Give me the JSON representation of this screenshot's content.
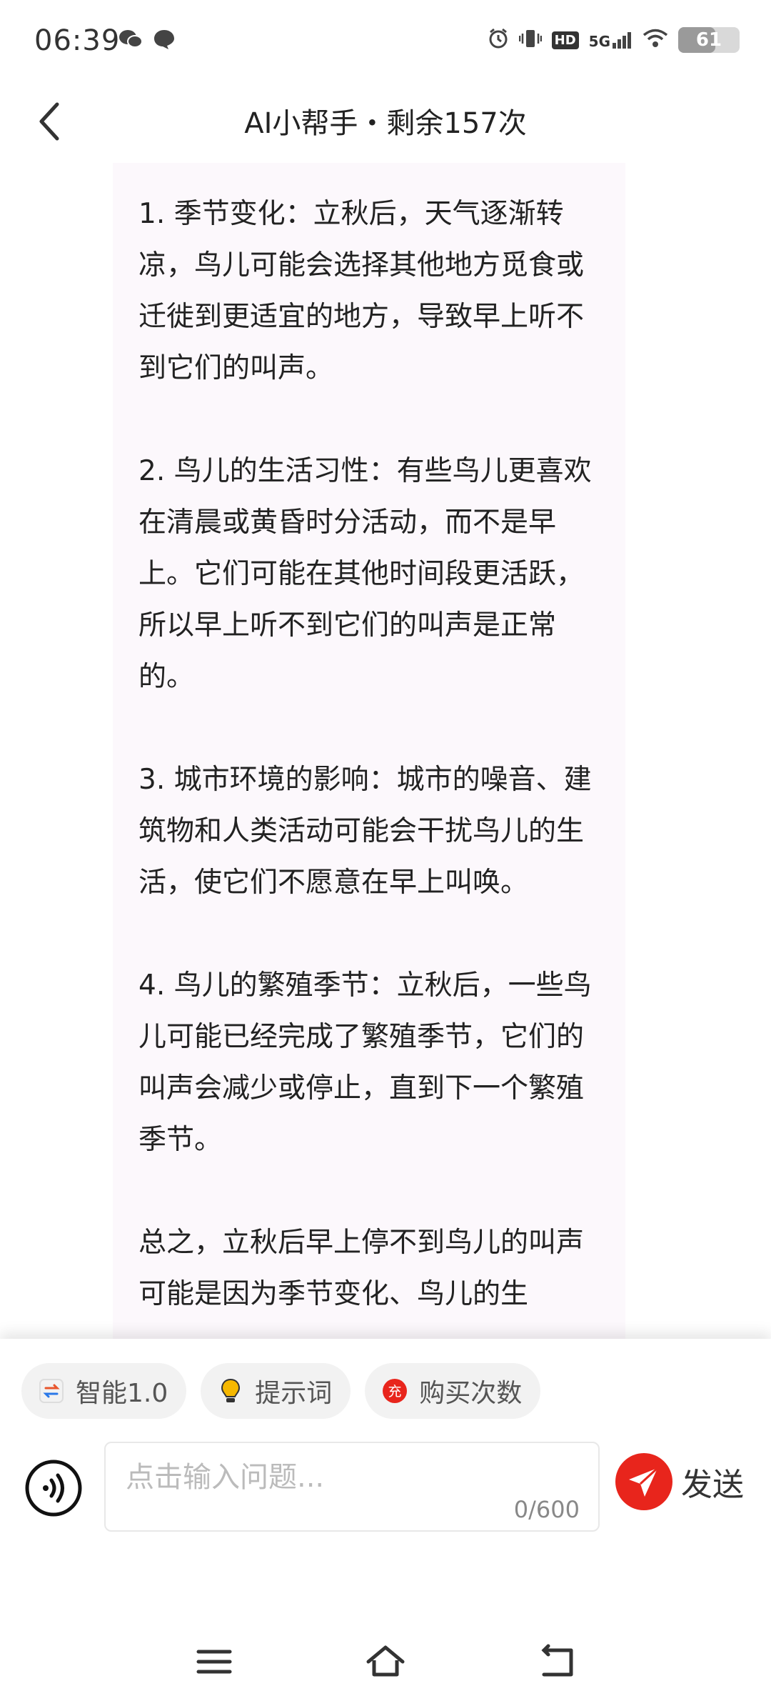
{
  "status_bar": {
    "time": "06:39",
    "network": "5G",
    "hd": "HD",
    "battery": "61",
    "battery_level": 0.61,
    "icons": [
      "wechat-icon",
      "message-icon",
      "alarm-icon",
      "vibrate-icon",
      "hd-icon",
      "signal-icon",
      "wifi-icon",
      "battery-icon"
    ]
  },
  "header": {
    "title": "AI小帮手・剩余157次",
    "back_icon": "chevron-left-icon"
  },
  "chat": {
    "message": "1. 季节变化：立秋后，天气逐渐转凉，鸟儿可能会选择其他地方觅食或迁徙到更适宜的地方，导致早上听不到它们的叫声。\n\n2. 鸟儿的生活习性：有些鸟儿更喜欢在清晨或黄昏时分活动，而不是早上。它们可能在其他时间段更活跃，所以早上听不到它们的叫声是正常的。\n\n3. 城市环境的影响：城市的噪音、建筑物和人类活动可能会干扰鸟儿的生活，使它们不愿意在早上叫唤。\n\n4. 鸟儿的繁殖季节：立秋后，一些鸟儿可能已经完成了繁殖季节，它们的叫声会减少或停止，直到下一个繁殖季节。\n\n总之，立秋后早上停不到鸟儿的叫声可能是因为季节变化、鸟儿的生"
  },
  "chips": [
    {
      "label": "智能1.0",
      "icon": "swap-icon"
    },
    {
      "label": "提示词",
      "icon": "lightbulb-icon"
    },
    {
      "label": "购买次数",
      "icon": "recharge-icon",
      "icon_text": "充"
    }
  ],
  "input": {
    "placeholder": "点击输入问题...",
    "value": "",
    "counter": "0/600"
  },
  "send": {
    "label": "发送",
    "icon": "paper-plane-icon"
  },
  "colors": {
    "accent": "#e8251c",
    "bubble_bg": "#fcf8fc",
    "chip_bg": "#f2f2f2"
  },
  "nav": {
    "icons": [
      "menu-icon",
      "home-icon",
      "back-icon"
    ]
  }
}
